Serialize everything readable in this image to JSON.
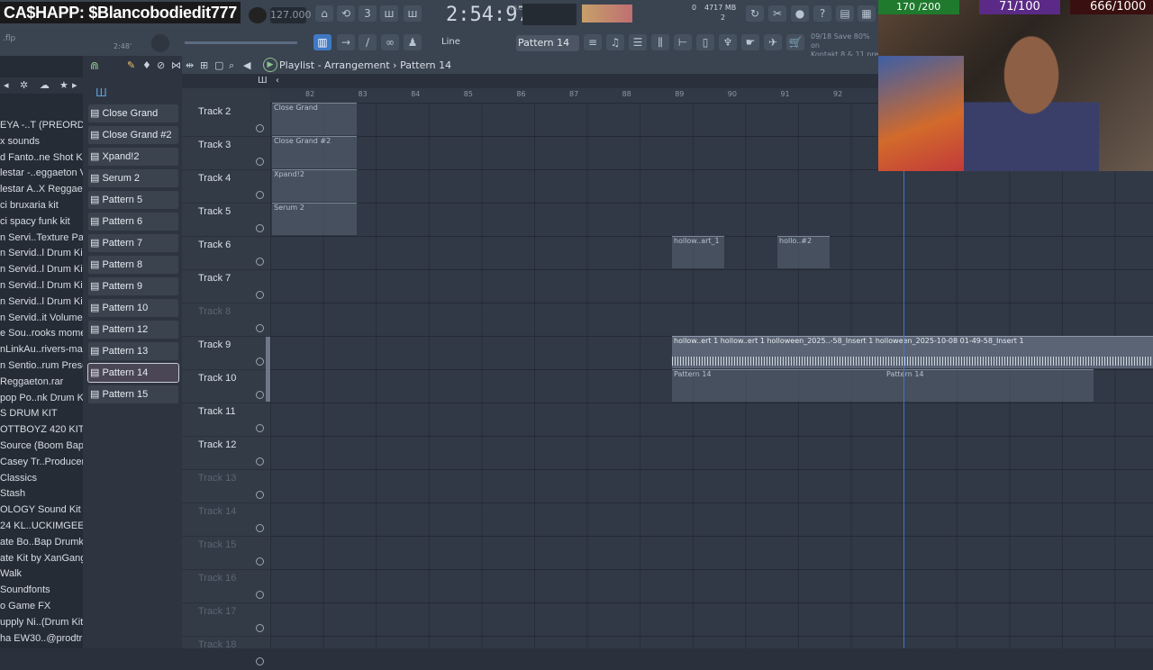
{
  "overlay": {
    "cashapp": "CA$HAPP: $Blancobodiedit777"
  },
  "transport": {
    "tempo": "127.000",
    "time": "2:54:97",
    "time_sub": "M:S:CS",
    "cpu": "0",
    "memory": "4717 MB",
    "voices": "2"
  },
  "toolbar": {
    "snap": "Line",
    "pattern": "Pattern 14",
    "hint_line1": "09/18  Save 80% on",
    "hint_line2": "Kontakt 8 & 11 pre",
    "file": ".flp",
    "file_time": "2:48'"
  },
  "playlist": {
    "title": "Playlist - Arrangement",
    "pattern": "Pattern 14"
  },
  "browser": {
    "items": [
      "EYA -..T (PREORDER)",
      "x sounds",
      "d Fanto..ne Shot Kit",
      "lestar -..eggaeton V2",
      "lestar A..X Reggaeton",
      "ci bruxaria kit",
      "ci spacy funk kit",
      "n Servi..Texture Pack",
      "n Servid..l Drum Kit 1",
      "n Servid..l Drum Kit 4",
      "n Servid..l Drum Kit 5",
      "n Servid..l Drum Kit 6",
      "n Servid..it Volume 5",
      "e Sou..rooks moment",
      "nLinkAu..rivers-main",
      "n Sentio..rum Presets",
      "Reggaeton.rar",
      "pop Po..nk Drum Kit",
      "S DRUM KIT",
      "OTTBOYZ 420 KIT",
      "Source (Boom Bap)",
      "Casey Tr..Producer Kit",
      "Classics",
      "Stash",
      "OLOGY Sound Kit",
      "24 KL..UCKIMGEEKED",
      "ate Bo..Bap Drumkit",
      "ate Kit by XanGang",
      "Walk",
      "Soundfonts",
      "o Game FX",
      "upply Ni..(Drum Kit)",
      "ha EW30..@prodtrivii"
    ]
  },
  "channels": [
    "Close Grand",
    "Close Grand #2",
    "Xpand!2",
    "Serum 2",
    "Pattern 5",
    "Pattern 6",
    "Pattern 7",
    "Pattern 8",
    "Pattern 9",
    "Pattern 10",
    "Pattern 12",
    "Pattern 13",
    "Pattern 14",
    "Pattern 15"
  ],
  "ruler": [
    "82",
    "83",
    "84",
    "85",
    "86",
    "87",
    "88",
    "89",
    "90",
    "91",
    "92"
  ],
  "tracks": [
    "Track 2",
    "Track 3",
    "Track 4",
    "Track 5",
    "Track 6",
    "Track 7",
    "Track 8",
    "Track 9",
    "Track 10",
    "Track 11",
    "Track 12",
    "Track 13",
    "Track 14",
    "Track 15",
    "Track 16",
    "Track 17",
    "Track 18"
  ],
  "clips": {
    "c1": "Close Grand",
    "c2": "Close Grand #2",
    "c3": "Xpand!2",
    "c4": "Serum 2",
    "h1": "hollow..art_1",
    "h2": "hollo..#2",
    "audio": "hollow..ert 1  hollow..ert 1  holloween_2025..-58_Insert 1  holloween_2025-10-08 01-49-58_Insert 1",
    "p14a": "Pattern 14",
    "p14b": "Pattern 14"
  },
  "stream": {
    "followers": "170 /200",
    "subs": "71/100",
    "goal": "666/1000"
  },
  "colors": {
    "accent": "#3f79c4",
    "selected_channel": "#4a4656",
    "stat_green": "#1f7a2d",
    "stat_purple": "#5b2a86"
  }
}
